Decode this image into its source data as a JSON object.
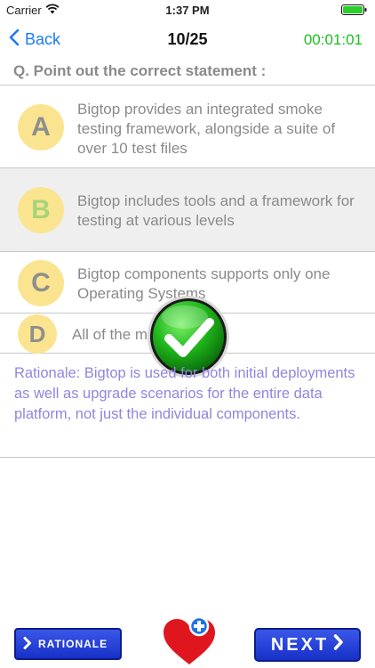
{
  "status_bar": {
    "carrier": "Carrier",
    "time": "1:37 PM"
  },
  "nav": {
    "back_label": "Back",
    "progress": "10/25",
    "timer": "00:01:01"
  },
  "question": "Q. Point out the correct statement :",
  "options": [
    {
      "letter": "A",
      "text": "Bigtop provides an integrated smoke testing framework, alongside a suite of over 10 test files",
      "selected": false
    },
    {
      "letter": "B",
      "text": "Bigtop includes tools and a framework for testing at various levels",
      "selected": true
    },
    {
      "letter": "C",
      "text": "Bigtop components supports only one Operating Systems",
      "selected": false
    },
    {
      "letter": "D",
      "text": "All of the mentioned",
      "selected": false
    }
  ],
  "rationale": "Rationale: Bigtop is used for both initial deployments as well as upgrade scenarios for the entire data platform, not just the individual components.",
  "buttons": {
    "rationale_label": "RATIONALE",
    "next_label": "NEXT"
  },
  "colors": {
    "accent": "#1a7cf5",
    "timer": "#19c11d",
    "circle": "#fbe48f",
    "rationale_text": "#8f86de",
    "button": "#1f3fd6"
  }
}
